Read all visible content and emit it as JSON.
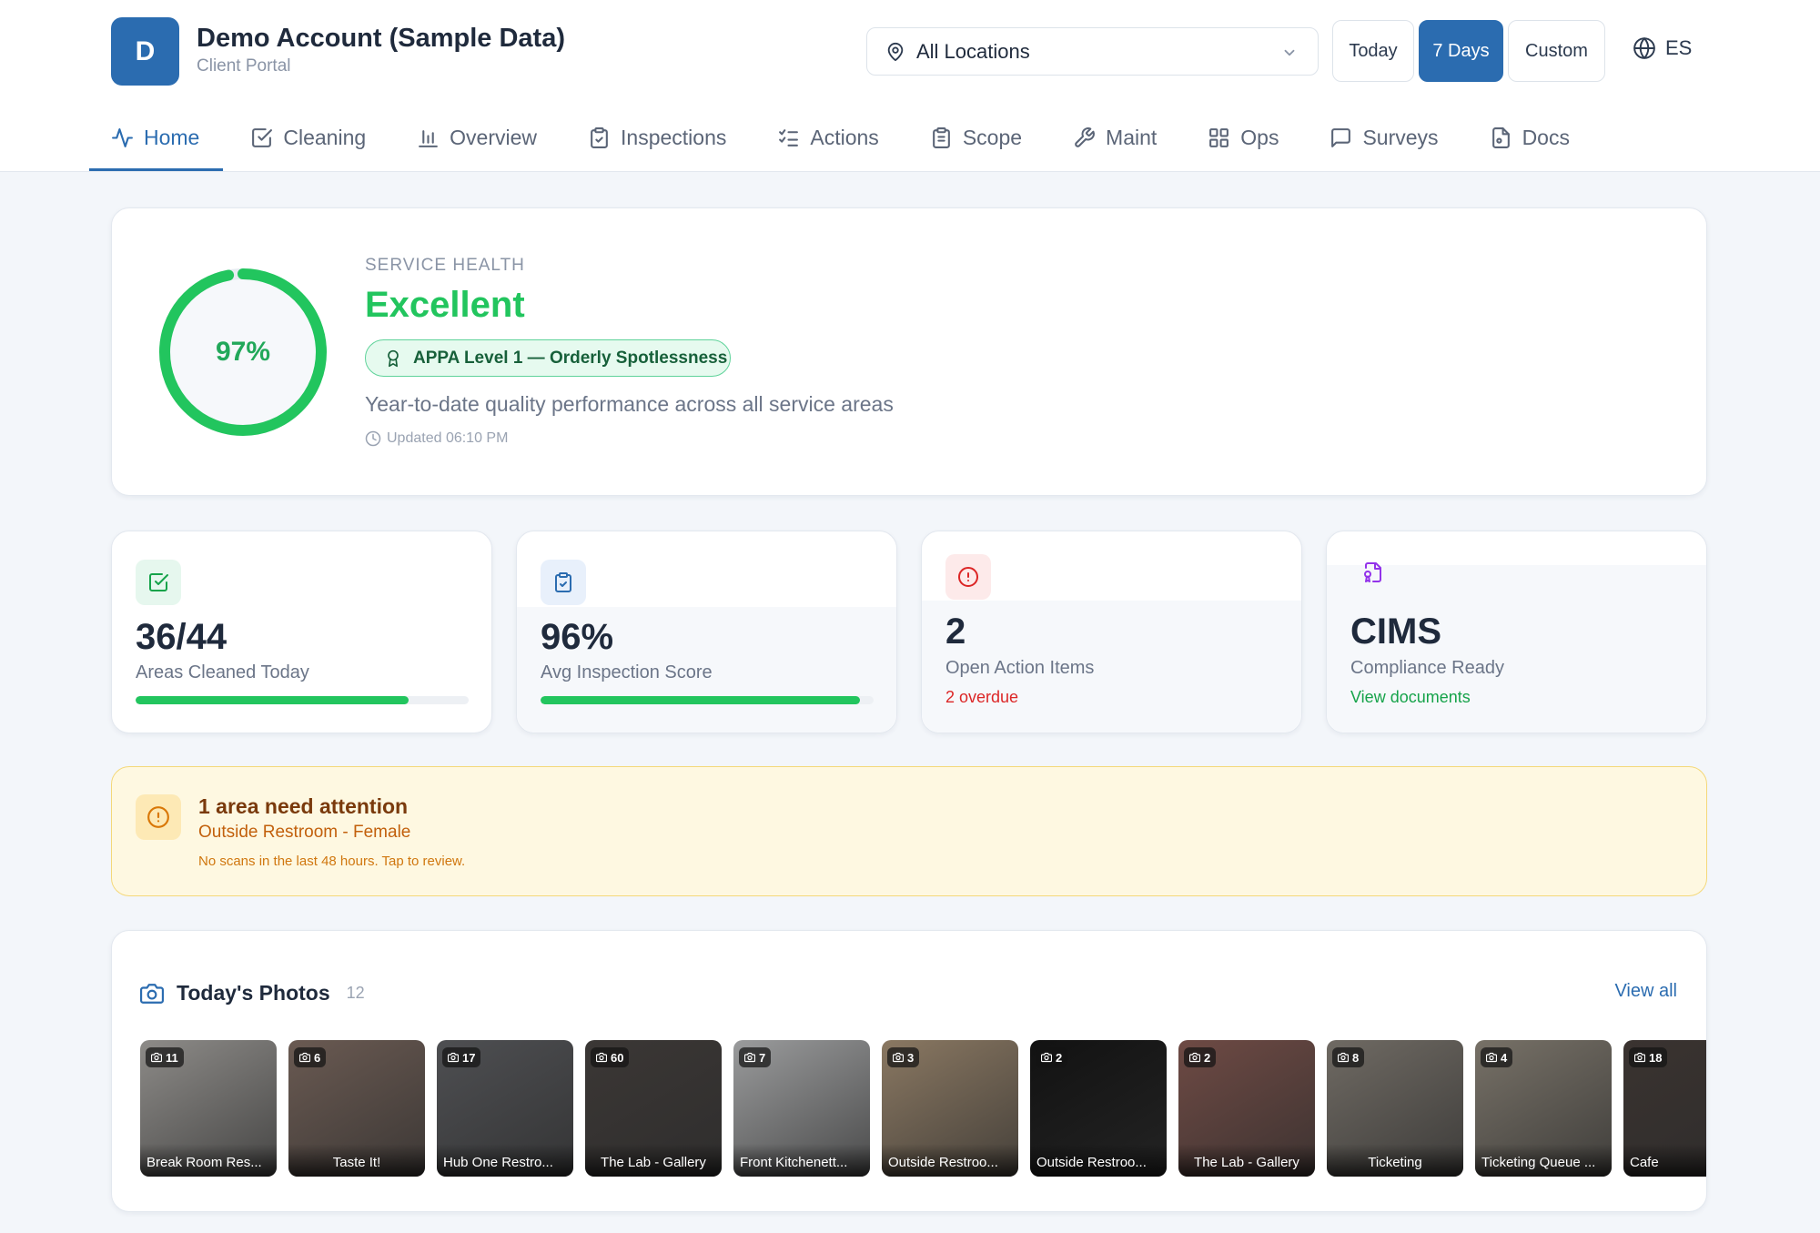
{
  "account": {
    "initial": "D",
    "name": "Demo Account (Sample Data)",
    "subtitle": "Client Portal"
  },
  "location_filter": {
    "value": "All Locations"
  },
  "date_range": {
    "options": [
      "Today",
      "7 Days",
      "Custom"
    ],
    "selected": "7 Days"
  },
  "language": "ES",
  "nav": [
    {
      "label": "Home",
      "icon": "activity-icon",
      "active": true
    },
    {
      "label": "Cleaning",
      "icon": "check-square-icon",
      "active": false
    },
    {
      "label": "Overview",
      "icon": "bar-chart-icon",
      "active": false
    },
    {
      "label": "Inspections",
      "icon": "clipboard-check-icon",
      "active": false
    },
    {
      "label": "Actions",
      "icon": "list-checks-icon",
      "active": false
    },
    {
      "label": "Scope",
      "icon": "clipboard-list-icon",
      "active": false
    },
    {
      "label": "Maint",
      "icon": "wrench-icon",
      "active": false
    },
    {
      "label": "Ops",
      "icon": "grid-icon",
      "active": false
    },
    {
      "label": "Surveys",
      "icon": "message-square-icon",
      "active": false
    },
    {
      "label": "Docs",
      "icon": "file-icon",
      "active": false
    }
  ],
  "service_health": {
    "label": "SERVICE HEALTH",
    "score_text": "97%",
    "score_fraction": 0.97,
    "status": "Excellent",
    "badge": "APPA Level 1 — Orderly Spotlessness",
    "description": "Year-to-date quality performance across all service areas",
    "updated": "Updated 06:10 PM",
    "color": "#22c55e"
  },
  "stats": [
    {
      "value": "36/44",
      "label": "Areas Cleaned Today",
      "progress": 0.82,
      "icon": "check-square-icon",
      "icon_color": "#16a34a",
      "icon_bg": "#e6f7ee"
    },
    {
      "value": "96%",
      "label": "Avg Inspection Score",
      "progress": 0.96,
      "icon": "clipboard-check-icon",
      "icon_color": "#2b6cb0",
      "icon_bg": "#e8f0fb"
    },
    {
      "value": "2",
      "label": "Open Action Items",
      "sub": "2 overdue",
      "sub_color": "#dc2626",
      "icon": "alert-circle-icon",
      "icon_color": "#dc2626",
      "icon_bg": "#fdeaea"
    },
    {
      "value": "CIMS",
      "label": "Compliance Ready",
      "sub": "View documents",
      "sub_color": "#16a34a",
      "icon": "file-badge-icon",
      "icon_color": "#9333ea",
      "icon_bg": "#f3e8fd"
    }
  ],
  "alert": {
    "title": "1 area need attention",
    "area": "Outside Restroom - Female",
    "note": "No scans in the last 48 hours. Tap to review."
  },
  "photos": {
    "title": "Today's Photos",
    "count": "12",
    "view_all": "View all",
    "items": [
      {
        "count": "11",
        "caption": "Break Room Res...",
        "bg": "#8d8b88"
      },
      {
        "count": "6",
        "caption": "Taste It!",
        "bg": "#6a5a52",
        "center": true
      },
      {
        "count": "17",
        "caption": "Hub One Restro...",
        "bg": "#4e4f52"
      },
      {
        "count": "60",
        "caption": "The Lab - Gallery",
        "bg": "#3b3735",
        "center": true
      },
      {
        "count": "7",
        "caption": "Front Kitchenett...",
        "bg": "#9a9b9c"
      },
      {
        "count": "3",
        "caption": "Outside Restroo...",
        "bg": "#8a7862"
      },
      {
        "count": "2",
        "caption": "Outside Restroo...",
        "bg": "#121212"
      },
      {
        "count": "2",
        "caption": "The Lab - Gallery",
        "bg": "#6e4a44",
        "center": true
      },
      {
        "count": "8",
        "caption": "Ticketing",
        "bg": "#6f6a63",
        "center": true
      },
      {
        "count": "4",
        "caption": "Ticketing Queue ...",
        "bg": "#777167"
      },
      {
        "count": "18",
        "caption": "Cafe",
        "bg": "#3a3330"
      }
    ]
  }
}
